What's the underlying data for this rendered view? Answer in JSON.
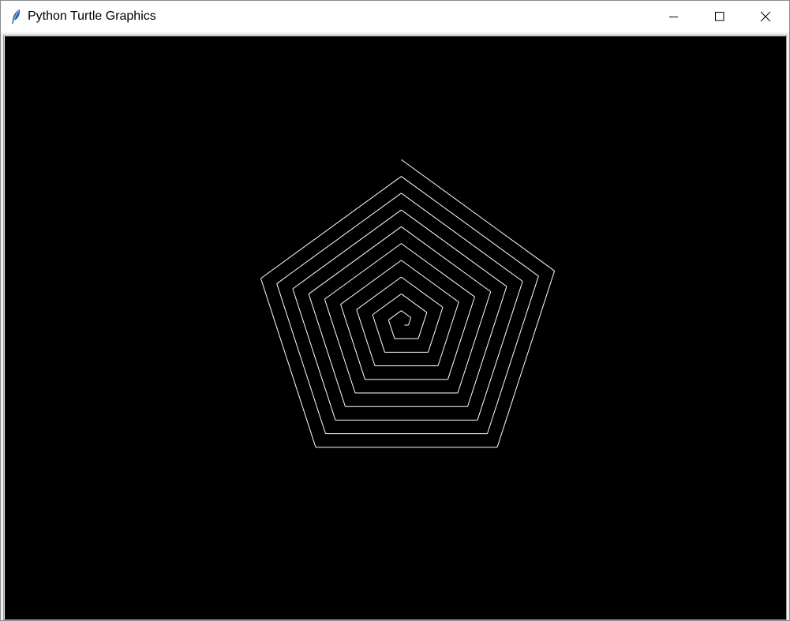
{
  "window": {
    "title": "Python Turtle Graphics",
    "icon": "feather-icon",
    "controls": {
      "minimize_icon": "minimize-icon",
      "maximize_icon": "maximize-icon",
      "close_icon": "close-icon"
    }
  },
  "canvas": {
    "background": "#000000",
    "pen_color": "#ffffff",
    "drawing": {
      "shape": "pentagon spiral",
      "sides": 5,
      "turn_angle_degrees": 72,
      "length_increment": 5,
      "segment_count": 48
    }
  }
}
